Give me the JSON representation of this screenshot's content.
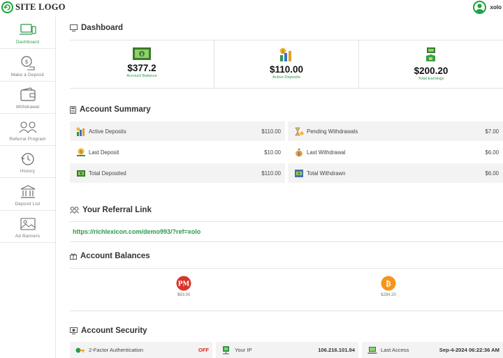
{
  "header": {
    "logo_text": "SITE LOGO",
    "username": "xolo"
  },
  "sidebar": {
    "items": [
      {
        "label": "Dashboard",
        "icon": "monitor-icon",
        "active": true
      },
      {
        "label": "Make a Deposit",
        "icon": "coin-deposit-icon"
      },
      {
        "label": "Withdrawal",
        "icon": "wallet-icon"
      },
      {
        "label": "Referral Program",
        "icon": "people-icon"
      },
      {
        "label": "History",
        "icon": "clock-history-icon"
      },
      {
        "label": "Deposit List",
        "icon": "bank-icon"
      },
      {
        "label": "Ad Banners",
        "icon": "image-folder-icon"
      }
    ]
  },
  "dashboard": {
    "title": "Dashboard",
    "cards": [
      {
        "value": "$377.2",
        "label": "Account Balance",
        "icon": "cash-icon"
      },
      {
        "value": "$110.00",
        "label": "Active Deposits",
        "icon": "coin-stack-icon"
      },
      {
        "value": "$200.20",
        "label": "Total Earnings",
        "icon": "hand-money-icon"
      }
    ]
  },
  "summary": {
    "title": "Account Summary",
    "left": [
      {
        "name": "Active Deposits",
        "value": "$110.00"
      },
      {
        "name": "Last Deposit",
        "value": "$10.00"
      },
      {
        "name": "Total Deposited",
        "value": "$110.00"
      }
    ],
    "right": [
      {
        "name": "Pending Withdrawals",
        "value": "$7.00"
      },
      {
        "name": "Last Withdrawal",
        "value": "$6.00"
      },
      {
        "name": "Total Withdrawn",
        "value": "$6.00"
      }
    ]
  },
  "referral": {
    "title": "Your Referral Link",
    "link": "https://richlexicon.com/demo993/?ref=xolo"
  },
  "balances": {
    "title": "Account Balances",
    "coins": [
      {
        "name": "PM",
        "amount": "$93.00",
        "color": "#d8352a"
      },
      {
        "name": "BTC",
        "amount": "$284.20",
        "color": "#f7931a"
      }
    ]
  },
  "security": {
    "title": "Account Security",
    "rows": [
      {
        "name": "2-Factor Authentication",
        "value": "OFF"
      },
      {
        "name": "Your IP",
        "value": "106.216.101.94"
      },
      {
        "name": "Last Access",
        "value": "Sep-4-2024 06:22:36 AM"
      }
    ]
  },
  "colors": {
    "accent": "#2a9a4a",
    "logo_green": "#1aa33a",
    "off_red": "#e0261b",
    "row_bg": "#f3f3f3"
  }
}
